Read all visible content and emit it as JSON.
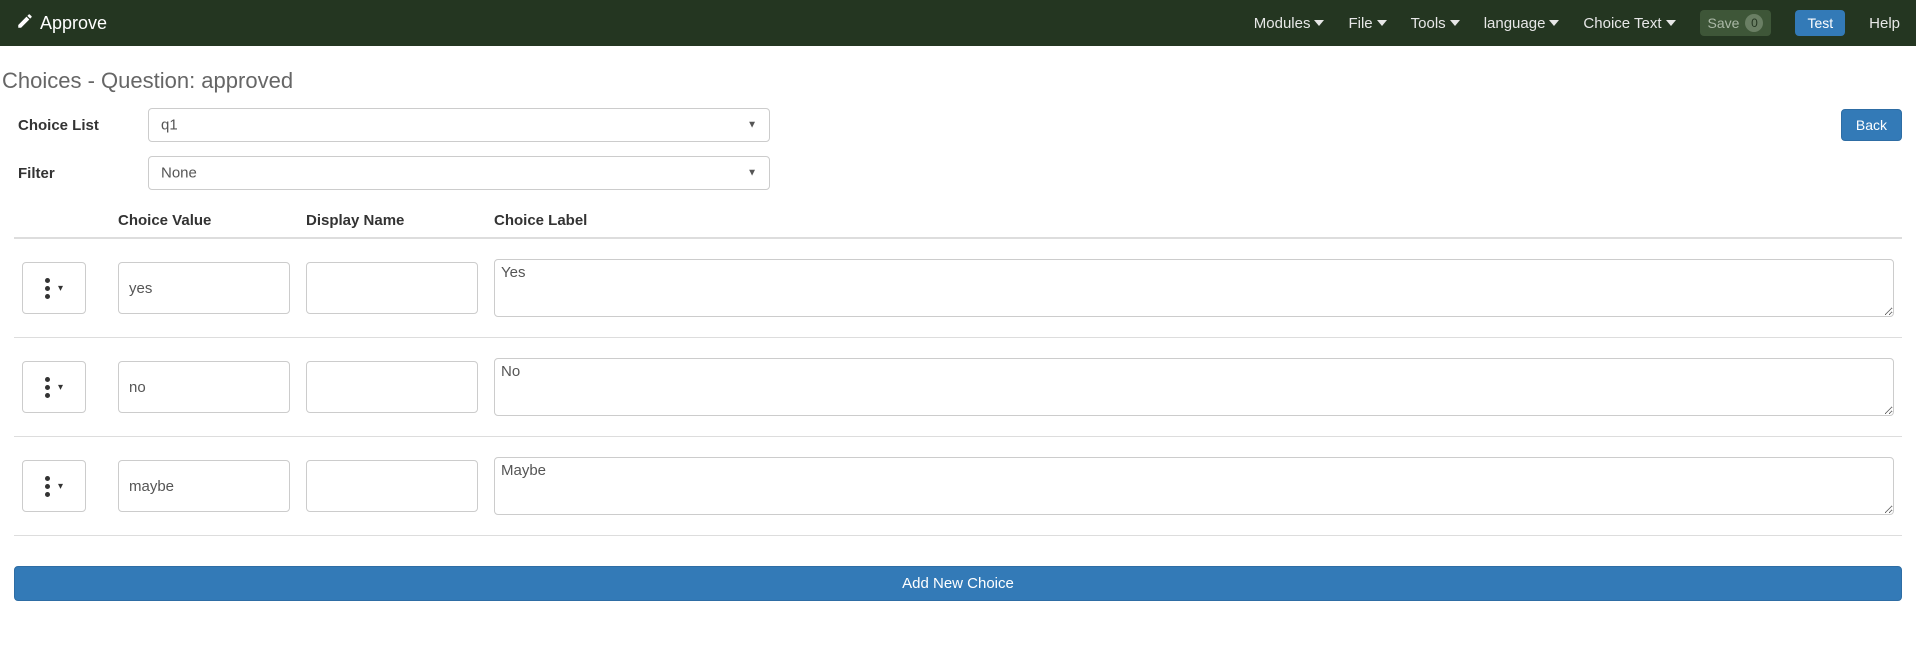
{
  "navbar": {
    "brand": "Approve",
    "menus": {
      "modules": "Modules",
      "file": "File",
      "tools": "Tools",
      "language": "language",
      "choice_text": "Choice Text"
    },
    "save_label": "Save",
    "save_count": "0",
    "test_label": "Test",
    "help_label": "Help"
  },
  "page": {
    "title": "Choices - Question: approved"
  },
  "form": {
    "choice_list_label": "Choice List",
    "choice_list_value": "q1",
    "filter_label": "Filter",
    "filter_value": "None",
    "back_label": "Back"
  },
  "table": {
    "headers": {
      "choice_value": "Choice Value",
      "display_name": "Display Name",
      "choice_label": "Choice Label"
    },
    "rows": [
      {
        "value": "yes",
        "display": "",
        "label": "Yes"
      },
      {
        "value": "no",
        "display": "",
        "label": "No"
      },
      {
        "value": "maybe",
        "display": "",
        "label": "Maybe"
      }
    ]
  },
  "add_button": "Add New Choice"
}
